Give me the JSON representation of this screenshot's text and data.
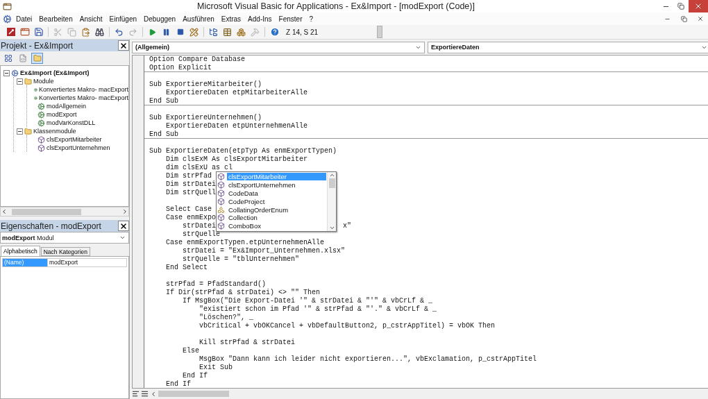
{
  "window": {
    "title": "Microsoft Visual Basic for Applications - Ex&Import - [modExport (Code)]"
  },
  "menu": [
    "Datei",
    "Bearbeiten",
    "Ansicht",
    "Einfügen",
    "Debuggen",
    "Ausführen",
    "Extras",
    "Add-Ins",
    "Fenster",
    "?"
  ],
  "toolbar": {
    "items": [
      {
        "kind": "access",
        "disabled": false
      },
      {
        "kind": "userform",
        "disabled": false
      },
      {
        "kind": "save",
        "disabled": false
      },
      {
        "kind": "separator"
      },
      {
        "kind": "cut",
        "disabled": true
      },
      {
        "kind": "copy",
        "disabled": true
      },
      {
        "kind": "paste",
        "disabled": false
      },
      {
        "kind": "find",
        "disabled": false
      },
      {
        "kind": "separator"
      },
      {
        "kind": "undo",
        "disabled": false
      },
      {
        "kind": "redo",
        "disabled": true
      },
      {
        "kind": "separator"
      },
      {
        "kind": "run",
        "disabled": false
      },
      {
        "kind": "pause",
        "disabled": false
      },
      {
        "kind": "stop",
        "disabled": false
      },
      {
        "kind": "design",
        "disabled": false
      },
      {
        "kind": "separator"
      },
      {
        "kind": "explorer",
        "disabled": false
      },
      {
        "kind": "properties",
        "disabled": false
      },
      {
        "kind": "browser",
        "disabled": false
      },
      {
        "kind": "toolbox",
        "disabled": true
      },
      {
        "kind": "separator"
      },
      {
        "kind": "help",
        "disabled": false
      }
    ],
    "position": "Z 14, S 21"
  },
  "project": {
    "title": "Projekt - Ex&Import",
    "view_buttons": [
      {
        "kind": "object",
        "selected": false
      },
      {
        "kind": "code",
        "selected": false
      },
      {
        "kind": "folders",
        "selected": true
      }
    ],
    "tree": [
      {
        "label": "Ex&Import (Ex&Import)",
        "kind": "project",
        "expanded": true,
        "children": [
          {
            "label": "Module",
            "kind": "folder",
            "expanded": true,
            "children": [
              {
                "label": "Konvertiertes Makro- macExport",
                "kind": "module"
              },
              {
                "label": "Konvertiertes Makro- macExport",
                "kind": "module"
              },
              {
                "label": "modAllgemein",
                "kind": "module"
              },
              {
                "label": "modExport",
                "kind": "module"
              },
              {
                "label": "modVarKonstDLL",
                "kind": "module"
              }
            ]
          },
          {
            "label": "Klassenmodule",
            "kind": "folder",
            "expanded": true,
            "children": [
              {
                "label": "clsExportMitarbeiter",
                "kind": "class"
              },
              {
                "label": "clsExportUnternehmen",
                "kind": "class"
              }
            ]
          }
        ]
      }
    ]
  },
  "properties": {
    "title": "Eigenschaften - modExport",
    "object": "**modExport** Modul",
    "tabs": [
      {
        "label": "Alphabetisch",
        "selected": true
      },
      {
        "label": "Nach Kategorien",
        "selected": false
      }
    ],
    "rows": [
      {
        "name": "(Name)",
        "value": "modExport",
        "selected": true
      }
    ]
  },
  "editor": {
    "object": "(Allgemein)",
    "procedure": "ExportiereDaten",
    "lines": [
      {
        "kind": "code",
        "text": "Option Compare Database"
      },
      {
        "kind": "code",
        "text": "Option Explicit"
      },
      {
        "kind": "rule"
      },
      {
        "kind": "blank"
      },
      {
        "kind": "code",
        "text": "Sub ExportiereMitarbeiter()"
      },
      {
        "kind": "code",
        "text": "    ExportiereDaten etpMitarbeiterAlle"
      },
      {
        "kind": "code",
        "text": "End Sub"
      },
      {
        "kind": "rule"
      },
      {
        "kind": "blank"
      },
      {
        "kind": "code",
        "text": "Sub ExportiereUnternehmen()"
      },
      {
        "kind": "code",
        "text": "    ExportiereDaten etpUnternehmenAlle"
      },
      {
        "kind": "code",
        "text": "End Sub"
      },
      {
        "kind": "rule"
      },
      {
        "kind": "blank"
      },
      {
        "kind": "code",
        "text": "Sub ExportiereDaten(etpTyp As enmExportTypen)"
      },
      {
        "kind": "code",
        "text": "    Dim clsExM As clsExportMitarbeiter"
      },
      {
        "kind": "code",
        "text": "    dim clsExU as cl"
      },
      {
        "kind": "code",
        "text": "    Dim strPfad"
      },
      {
        "kind": "code",
        "text": "    Dim strDatei"
      },
      {
        "kind": "code",
        "text": "    Dim strQuell"
      },
      {
        "kind": "blank"
      },
      {
        "kind": "code",
        "text": "    Select Case"
      },
      {
        "kind": "code",
        "text": "    Case enmExpo"
      },
      {
        "kind": "split",
        "text": "        strDatei",
        "tail": "x\""
      },
      {
        "kind": "code",
        "text": "        strQuelle"
      },
      {
        "kind": "code",
        "text": "    Case enmExportTypen.etpUnternehmenAlle"
      },
      {
        "kind": "code",
        "text": "        strDatei = \"Ex&Import_Unternehmen.xlsx\""
      },
      {
        "kind": "code",
        "text": "        strQuelle = \"tblUnternehmen\""
      },
      {
        "kind": "code",
        "text": "    End Select"
      },
      {
        "kind": "blank"
      },
      {
        "kind": "code",
        "text": "    strPfad = PfadStandard()"
      },
      {
        "kind": "code",
        "text": "    If Dir(strPfad & strDatei) <> \"\" Then"
      },
      {
        "kind": "code",
        "text": "        If MsgBox(\"Die Export-Datei '\" & strDatei & \"'\" & vbCrLf & _"
      },
      {
        "kind": "code",
        "text": "            \"existiert schon im Pfad '\" & strPfad & \"'.\" & vbCrLf & _"
      },
      {
        "kind": "code",
        "text": "            \"Löschen?\", _"
      },
      {
        "kind": "code",
        "text": "            vbCritical + vbOKCancel + vbDefaultButton2, p_cstrAppTitel) = vbOK Then"
      },
      {
        "kind": "blank"
      },
      {
        "kind": "code",
        "text": "            Kill strPfad & strDatei"
      },
      {
        "kind": "code",
        "text": "        Else"
      },
      {
        "kind": "code",
        "text": "            MsgBox \"Dann kann ich leider nicht exportieren...\", vbExclamation, p_cstrAppTitel"
      },
      {
        "kind": "code",
        "text": "            Exit Sub"
      },
      {
        "kind": "code",
        "text": "        End If"
      },
      {
        "kind": "code",
        "text": "    End If"
      }
    ],
    "completion": {
      "items": [
        {
          "label": "clsExportMitarbeiter",
          "kind": "class",
          "selected": true
        },
        {
          "label": "clsExportUnternehmen",
          "kind": "class",
          "selected": false
        },
        {
          "label": "CodeData",
          "kind": "class",
          "selected": false
        },
        {
          "label": "CodeProject",
          "kind": "class",
          "selected": false
        },
        {
          "label": "CollatingOrderEnum",
          "kind": "enum",
          "selected": false
        },
        {
          "label": "Collection",
          "kind": "class",
          "selected": false
        },
        {
          "label": "ComboBox",
          "kind": "class",
          "selected": false
        }
      ]
    }
  }
}
